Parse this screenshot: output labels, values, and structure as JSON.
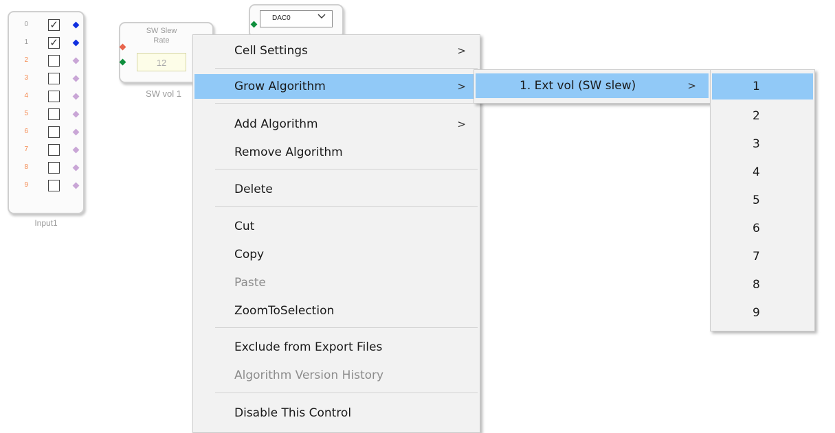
{
  "input_block": {
    "caption": "Input1",
    "rows": [
      {
        "num": "0",
        "checked": true
      },
      {
        "num": "1",
        "checked": true
      },
      {
        "num": "2",
        "checked": false
      },
      {
        "num": "3",
        "checked": false
      },
      {
        "num": "4",
        "checked": false
      },
      {
        "num": "5",
        "checked": false
      },
      {
        "num": "6",
        "checked": false
      },
      {
        "num": "7",
        "checked": false
      },
      {
        "num": "8",
        "checked": false
      },
      {
        "num": "9",
        "checked": false
      }
    ],
    "checked_row_num_color": "#9a9a9a",
    "unchecked_row_num_color": "#f5894f",
    "active_pin_color": "#1030e0",
    "inactive_pin_color": "#c9a6d6",
    "check_glyph": "✓"
  },
  "slew_block": {
    "title": "SW Slew Rate",
    "value": "12",
    "caption": "SW vol 1",
    "input_pin_color": "#e8654c",
    "green_pin_color": "#0f8f3d"
  },
  "dac_block": {
    "selected": "DAC0",
    "pin_color": "#0f8f3d"
  },
  "context_menu": {
    "items": [
      {
        "label": "Cell Settings",
        "has_submenu": true
      },
      {
        "label": "Grow Algorithm",
        "has_submenu": true,
        "highlighted": true
      },
      {
        "label": "Add Algorithm",
        "has_submenu": true
      },
      {
        "label": "Remove Algorithm"
      },
      {
        "label": "Delete"
      },
      {
        "label": "Cut"
      },
      {
        "label": "Copy"
      },
      {
        "label": "Paste",
        "disabled": true
      },
      {
        "label": "ZoomToSelection"
      },
      {
        "label": "Exclude from Export Files"
      },
      {
        "label": "Algorithm Version History",
        "disabled": true
      },
      {
        "label": "Disable This Control"
      }
    ],
    "submenu_arrow": ">",
    "highlight_color": "#91c9f7"
  },
  "grow_submenu": {
    "items": [
      {
        "label": "1. Ext vol (SW slew)",
        "has_submenu": true,
        "highlighted": true
      }
    ]
  },
  "count_submenu": {
    "items": [
      "1",
      "2",
      "3",
      "4",
      "5",
      "6",
      "7",
      "8",
      "9"
    ],
    "highlighted_index": 0
  }
}
